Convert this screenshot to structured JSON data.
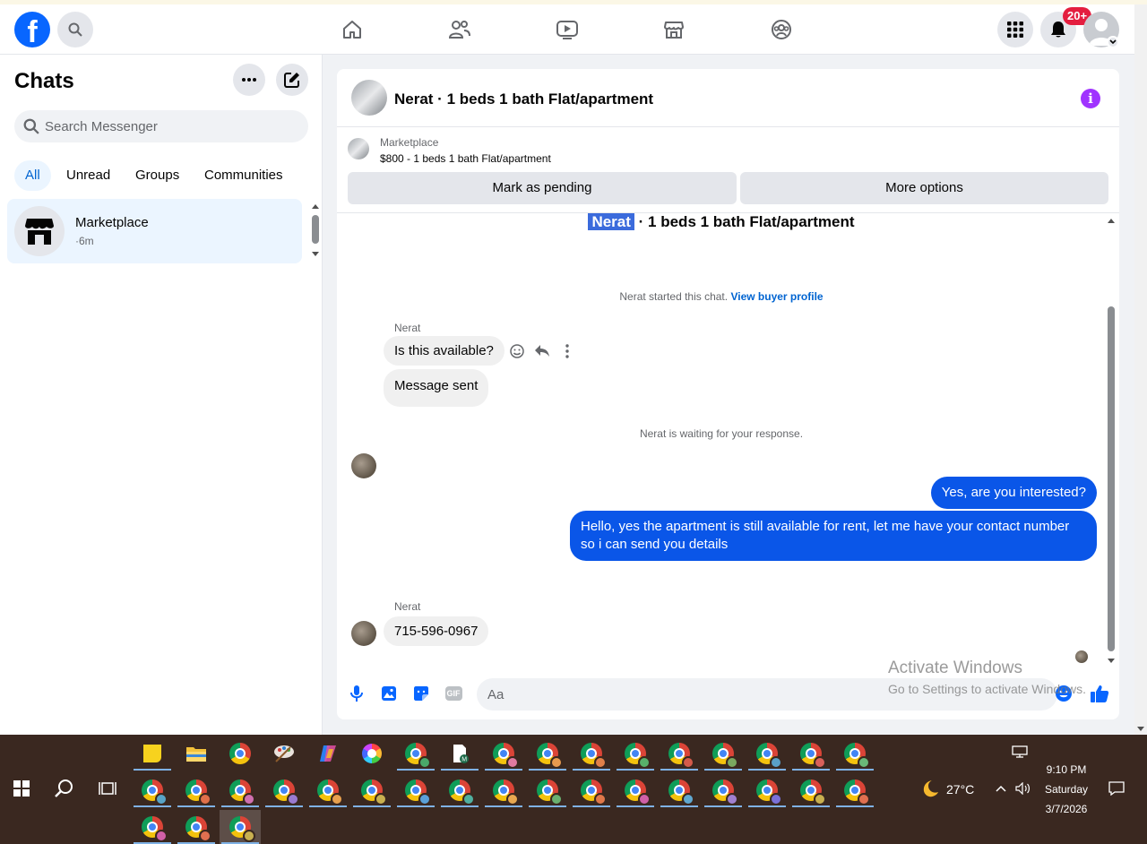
{
  "sidebar": {
    "title": "Chats",
    "search_placeholder": "Search Messenger",
    "filters": [
      {
        "label": "All"
      },
      {
        "label": "Unread"
      },
      {
        "label": "Groups"
      },
      {
        "label": "Communities"
      }
    ],
    "chats": [
      {
        "name": "Marketplace",
        "time": "·6m"
      }
    ]
  },
  "topnav": {
    "notification_count": "20+"
  },
  "conversation": {
    "title": "Nerat · 1 beds 1 bath Flat/apartment",
    "marketplace_label": "Marketplace",
    "listing": "$800 - 1 beds 1 bath Flat/apartment",
    "mark_pending_label": "Mark as pending",
    "more_options_label": "More options",
    "echo_name": "Nerat",
    "echo_rest": "· 1 beds 1 bath Flat/apartment",
    "started_text": "Nerat started this chat.",
    "view_profile_link": "View buyer profile",
    "sender_name": "Nerat",
    "msg_available": "Is this available?",
    "msg_sent": "Message sent",
    "waiting_text": "Nerat is waiting for your response.",
    "out_msg_1": "Yes, are you interested?",
    "out_msg_2": "Hello, yes the apartment is still available for rent, let me have your contact number so i can send you details",
    "sender_name_2": "Nerat",
    "msg_phone": "715-596-0967",
    "composer_placeholder": "Aa"
  },
  "watermark": {
    "line1": "Activate Windows",
    "line2": "Go to Settings to activate Windows."
  },
  "taskbar": {
    "temperature": "27°C",
    "time": "9:10 PM",
    "day": "Saturday",
    "date": "3/7/2026"
  },
  "colors": {
    "facebook_blue": "#0866ff",
    "outgoing_bubble": "#0a56e8",
    "badge_red": "#e41e3f",
    "info_purple": "#a033ff"
  }
}
